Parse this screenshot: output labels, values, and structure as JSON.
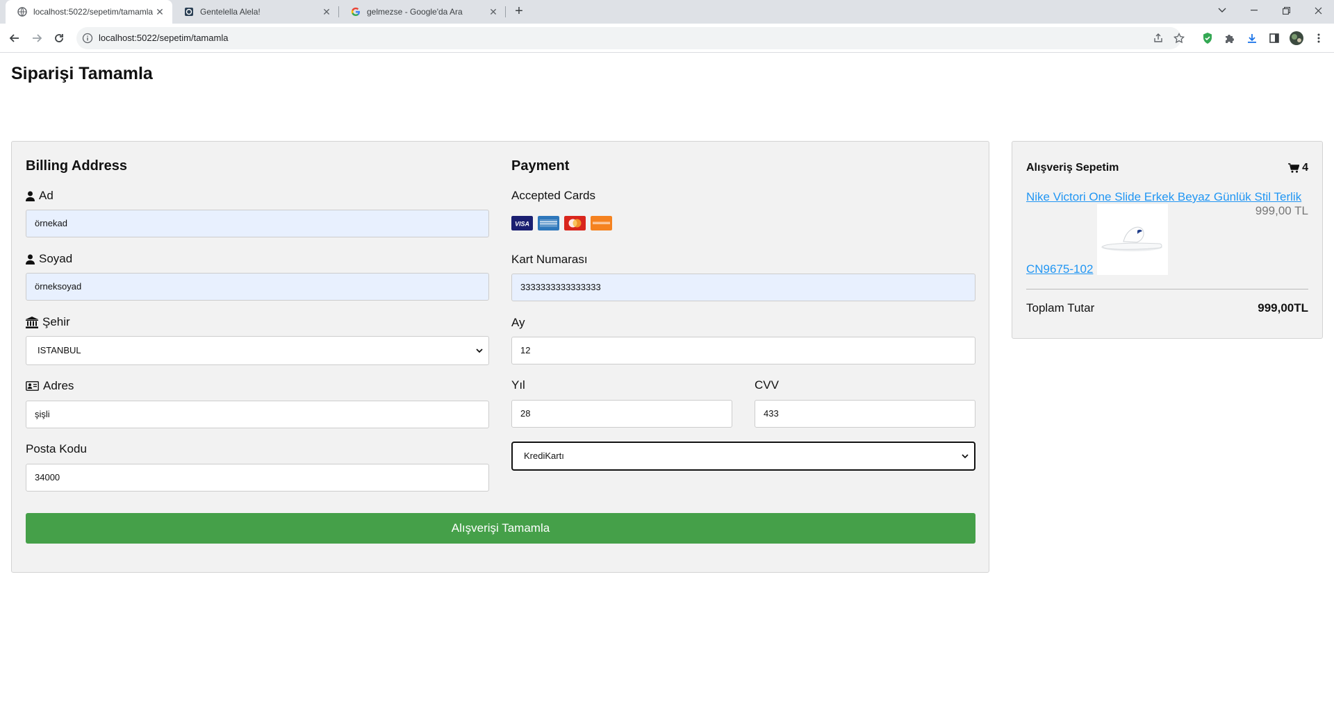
{
  "browser": {
    "tabs": [
      {
        "title": "localhost:5022/sepetim/tamamla",
        "active": true
      },
      {
        "title": "Gentelella Alela!",
        "active": false
      },
      {
        "title": "gelmezse - Google'da Ara",
        "active": false
      }
    ],
    "url": "localhost:5022/sepetim/tamamla"
  },
  "page": {
    "title": "Siparişi Tamamla"
  },
  "billing": {
    "heading": "Billing Address",
    "ad_label": "Ad",
    "ad_value": "örnekad",
    "soyad_label": "Soyad",
    "soyad_value": "örneksoyad",
    "sehir_label": "Şehir",
    "sehir_value": "ISTANBUL",
    "adres_label": "Adres",
    "adres_value": "şişli",
    "posta_label": "Posta Kodu",
    "posta_value": "34000"
  },
  "payment": {
    "heading": "Payment",
    "accepted_cards_label": "Accepted Cards",
    "cards": [
      "visa",
      "amex",
      "mastercard",
      "discover"
    ],
    "kart_label": "Kart Numarası",
    "kart_value": "3333333333333333",
    "ay_label": "Ay",
    "ay_value": "12",
    "yil_label": "Yıl",
    "yil_value": "28",
    "cvv_label": "CVV",
    "cvv_value": "433",
    "method_value": "KrediKartı"
  },
  "submit_label": "Alışverişi Tamamla",
  "cart": {
    "title": "Alışveriş Sepetim",
    "count": "4",
    "product_name": "Nike Victori One Slide Erkek Beyaz Günlük Stil Terlik",
    "product_price": "999,00 TL",
    "product_code": "CN9675-102",
    "total_label": "Toplam Tutar",
    "total_value": "999,00TL"
  },
  "colors": {
    "submit": "#45a049",
    "link": "#2196f3",
    "card_bg": "#f2f2f2",
    "autofill": "#e8f0fe"
  }
}
